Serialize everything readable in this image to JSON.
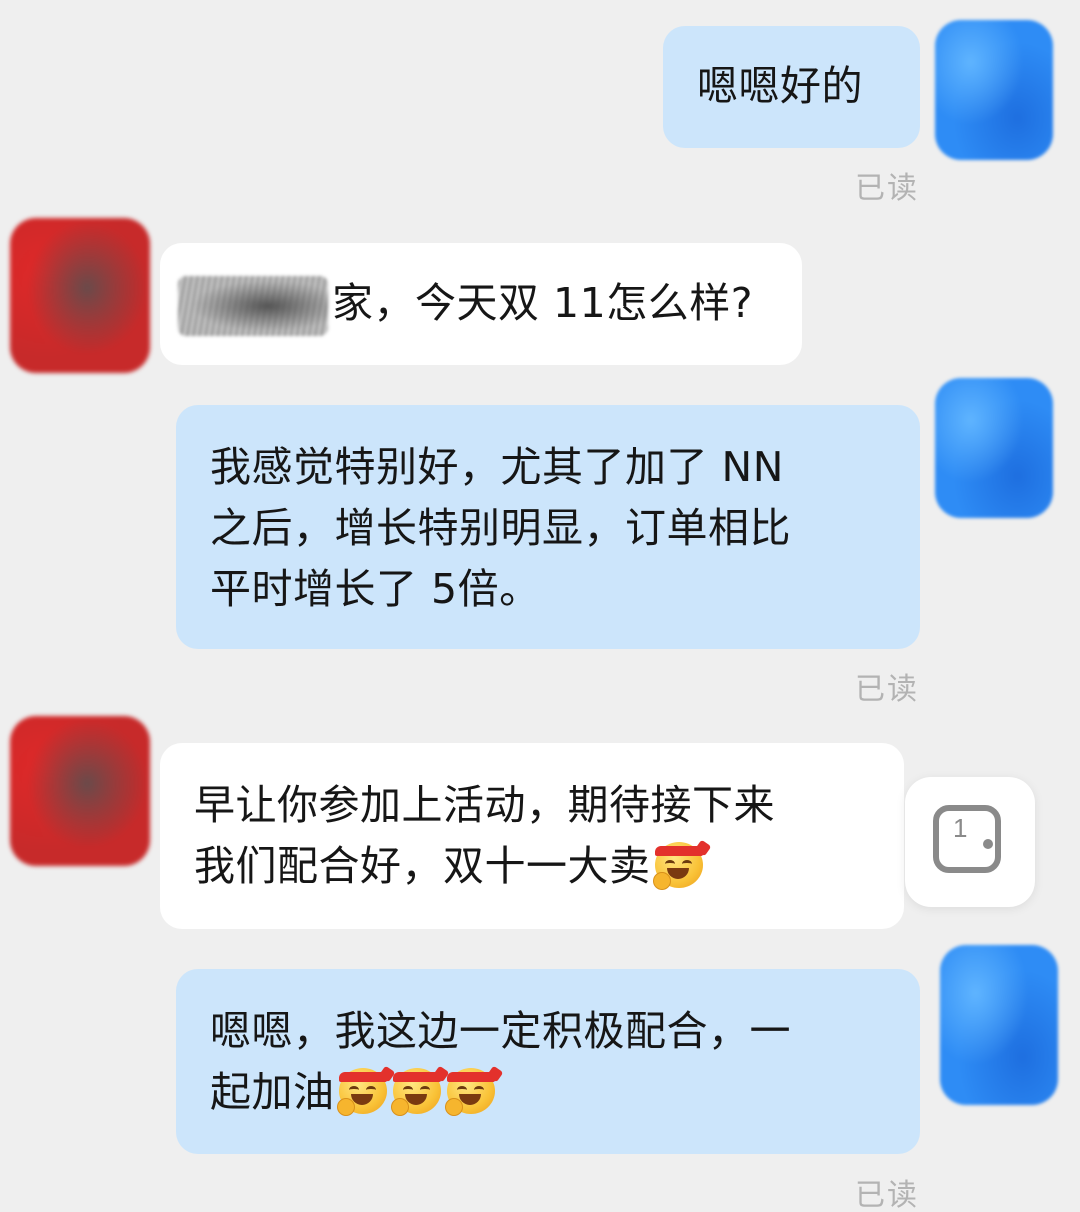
{
  "messages": [
    {
      "side": "me",
      "lines": [
        "嗯嗯好的"
      ],
      "receipt": "已读"
    },
    {
      "side": "them",
      "lines": [
        "家，今天双 11怎么样?"
      ]
    },
    {
      "side": "me",
      "lines": [
        "我感觉特别好，尤其了加了 NN",
        "之后，增长特别明显，订单相比",
        "平时增长了 5倍。"
      ],
      "receipt": "已读"
    },
    {
      "side": "them",
      "lines": [
        "早让你参加上活动，期待接下来",
        "我们配合好，双十一大卖"
      ]
    },
    {
      "side": "me",
      "lines": [
        "嗯嗯，我这边一定积极配合，一",
        "起加油"
      ],
      "receipt": "已读"
    }
  ],
  "colors": {
    "background": "#efefef",
    "my_bubble": "#cce5fb",
    "their_bubble": "#ffffff",
    "read_receipt": "#b3b3b3"
  },
  "icons": {
    "emoji": "grinning-face-with-headband-emoji",
    "floating_button": "dice-icon"
  },
  "floating_button_number": "1"
}
